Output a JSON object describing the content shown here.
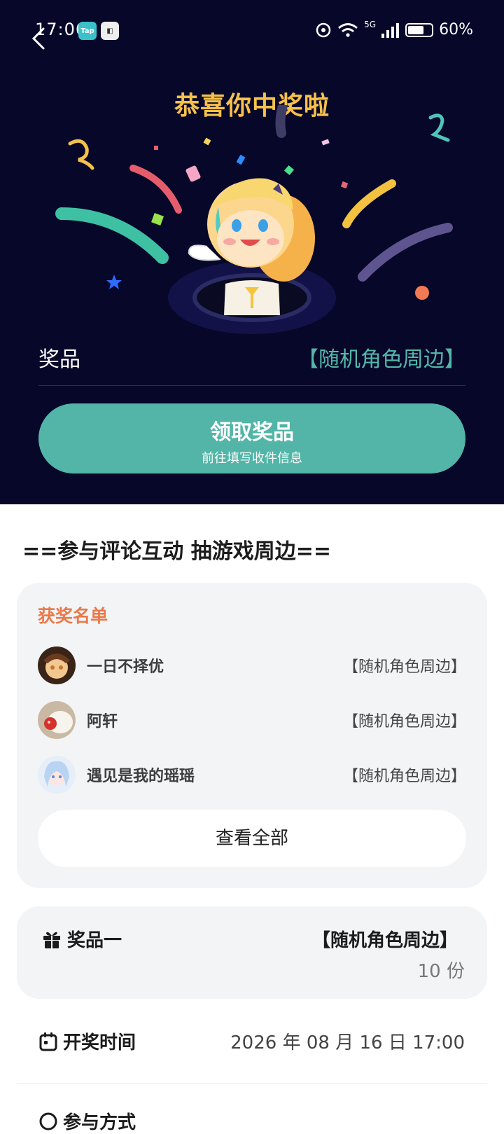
{
  "status_bar": {
    "time": "17:06",
    "battery": "60%",
    "network": "5G"
  },
  "hero": {
    "title": "恭喜你中奖啦",
    "prize_label": "奖品",
    "prize_value": "【随机角色周边】",
    "claim_button": {
      "title": "领取奖品",
      "subtitle": "前往填写收件信息"
    },
    "accent": "#52b5a7",
    "background": "#07072a"
  },
  "section_title": "==参与评论互动 抽游戏周边==",
  "winners": {
    "title": "获奖名单",
    "items": [
      {
        "name": "一日不择优",
        "prize": "【随机角色周边】"
      },
      {
        "name": "阿轩",
        "prize": "【随机角色周边】"
      },
      {
        "name": "遇见是我的瑶瑶",
        "prize": "【随机角色周边】"
      }
    ],
    "view_all": "查看全部"
  },
  "prize_one": {
    "label": "奖品一",
    "value": "【随机角色周边】",
    "count": "10 份"
  },
  "draw_time": {
    "label": "开奖时间",
    "value": "2026 年 08 月 16 日 17:00"
  },
  "participation": {
    "label": "参与方式"
  }
}
